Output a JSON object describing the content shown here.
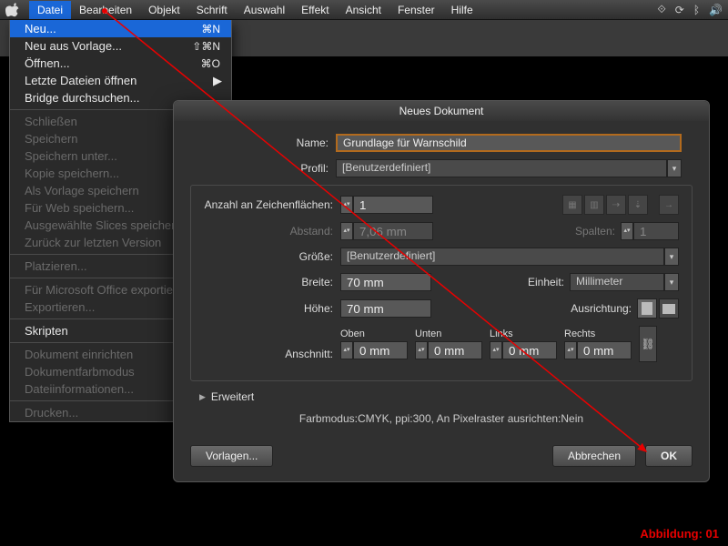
{
  "menubar": {
    "items": [
      "Datei",
      "Bearbeiten",
      "Objekt",
      "Schrift",
      "Auswahl",
      "Effekt",
      "Ansicht",
      "Fenster",
      "Hilfe"
    ]
  },
  "dropdown": {
    "items": [
      {
        "label": "Neu...",
        "shortcut": "⌘N",
        "hl": true
      },
      {
        "label": "Neu aus Vorlage...",
        "shortcut": "⇧⌘N"
      },
      {
        "label": "Öffnen...",
        "shortcut": "⌘O"
      },
      {
        "label": "Letzte Dateien öffnen",
        "submenu": true
      },
      {
        "label": "Bridge durchsuchen..."
      },
      {
        "sep": true
      },
      {
        "label": "Schließen",
        "dim": true
      },
      {
        "label": "Speichern",
        "dim": true
      },
      {
        "label": "Speichern unter...",
        "dim": true
      },
      {
        "label": "Kopie speichern...",
        "dim": true
      },
      {
        "label": "Als Vorlage speichern",
        "dim": true
      },
      {
        "label": "Für Web speichern...",
        "dim": true
      },
      {
        "label": "Ausgewählte Slices speichern",
        "dim": true
      },
      {
        "label": "Zurück zur letzten Version",
        "dim": true
      },
      {
        "sep": true
      },
      {
        "label": "Platzieren...",
        "dim": true
      },
      {
        "sep": true
      },
      {
        "label": "Für Microsoft Office exportieren",
        "dim": true
      },
      {
        "label": "Exportieren...",
        "dim": true
      },
      {
        "sep": true
      },
      {
        "label": "Skripten"
      },
      {
        "sep": true
      },
      {
        "label": "Dokument einrichten",
        "dim": true
      },
      {
        "label": "Dokumentfarbmodus",
        "dim": true
      },
      {
        "label": "Dateiinformationen...",
        "dim": true
      },
      {
        "sep": true
      },
      {
        "label": "Drucken...",
        "dim": true
      }
    ]
  },
  "dialog": {
    "title": "Neues Dokument",
    "nameLabel": "Name:",
    "name": "Grundlage für Warnschild",
    "profileLabel": "Profil:",
    "profile": "[Benutzerdefiniert]",
    "artboardCountLabel": "Anzahl an Zeichenflächen:",
    "artboardCount": "1",
    "spacingLabel": "Abstand:",
    "spacing": "7,06 mm",
    "columnsLabel": "Spalten:",
    "columns": "1",
    "sizeLabel": "Größe:",
    "size": "[Benutzerdefiniert]",
    "widthLabel": "Breite:",
    "width": "70 mm",
    "unitLabel": "Einheit:",
    "unit": "Millimeter",
    "heightLabel": "Höhe:",
    "height": "70 mm",
    "orientationLabel": "Ausrichtung:",
    "bleedLabel": "Anschnitt:",
    "bleedTop": "Oben",
    "bleedBottom": "Unten",
    "bleedLeft": "Links",
    "bleedRight": "Rechts",
    "bleedVal": "0 mm",
    "advanced": "Erweitert",
    "summary": "Farbmodus:CMYK, ppi:300, An Pixelraster ausrichten:Nein",
    "templates": "Vorlagen...",
    "cancel": "Abbrechen",
    "ok": "OK"
  },
  "caption": "Abbildung: 01"
}
